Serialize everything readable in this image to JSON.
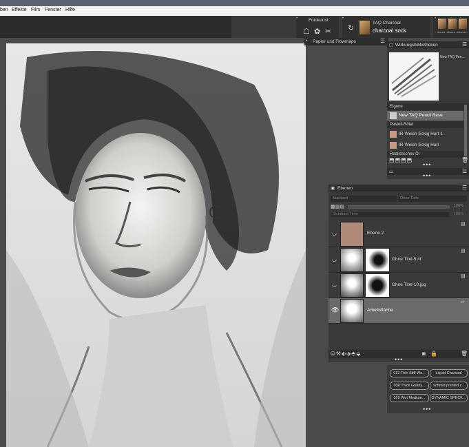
{
  "menu": {
    "partial_first": "ben",
    "items": [
      "Effekte",
      "Film",
      "Fenster",
      "Hilfe"
    ]
  },
  "toolbar": {
    "fotokunst_label": "Fotokunst",
    "brush_category": "TAQ Charcoal",
    "brush_variant": "charcoal sock",
    "strip_items": [
      "charco...",
      "charco...",
      "charco..."
    ]
  },
  "panels": {
    "paper": {
      "title": "Papier und Flowmaps"
    },
    "effects": {
      "title": "Wirkungsbibliotheken",
      "preview_label": "New TAQ Pen...",
      "groups": [
        {
          "name": "Eigene",
          "items": [
            "New TAQ Pencil Base"
          ]
        },
        {
          "name": "Pastell-Rötel",
          "items": [
            "IR-Weich Eckig Hart-1",
            "IR-Weich Eckig Hart"
          ]
        },
        {
          "name": "Realistisches Öl",
          "items": []
        }
      ]
    },
    "layers": {
      "title": "Ebenen",
      "composite": "Standard",
      "depth": "Ohne Tiefe",
      "opacity": "100%",
      "visible_depth_label": "Sichtbare Tiefe",
      "depth_value": "100%",
      "rows": [
        {
          "name": "Ebene 2",
          "eye": false
        },
        {
          "name": "Ohne Titel-5.rif",
          "eye": true
        },
        {
          "name": "Ohne Titel-10.jpg",
          "eye": true
        },
        {
          "name": "Arbeitsfläche",
          "eye": true
        }
      ]
    },
    "brushes": {
      "buttons": [
        [
          "012 Thin Stiff Wo...",
          "Liquid Charcoal"
        ],
        [
          "030 Thick Grainy...",
          "schmid pointed r..."
        ],
        [
          "020 Wet Medium...",
          "DYNAMIC SPECK..."
        ]
      ]
    }
  },
  "colors": {
    "menubar": "#f3f3f3",
    "panel": "#393939",
    "selected_row": "#6a6a6a",
    "accent_layer": "#b08a78"
  }
}
